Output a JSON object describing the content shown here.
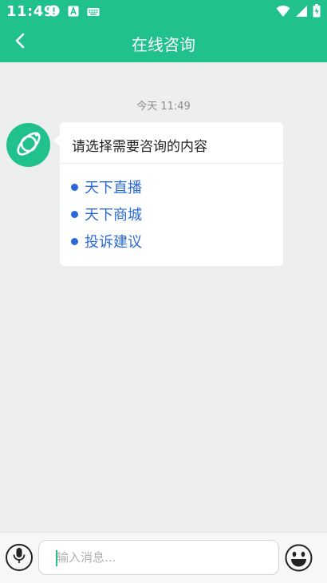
{
  "status_bar": {
    "time": "11:49",
    "left_icons": [
      "alert-icon",
      "app-icon",
      "keyboard-icon"
    ],
    "right_icons": [
      "wifi-icon",
      "signal-icon",
      "battery-icon"
    ]
  },
  "header": {
    "title": "在线咨询",
    "background": "#20c18d",
    "back_icon": "chevron-left-icon"
  },
  "chat": {
    "timestamp": "今天 11:49",
    "bot_avatar_icon": "planet-logo-icon",
    "message": {
      "prompt": "请选择需要咨询的内容",
      "options": [
        {
          "label": "天下直播"
        },
        {
          "label": "天下商城"
        },
        {
          "label": "投诉建议"
        }
      ],
      "link_color": "#2a69d8"
    }
  },
  "input_bar": {
    "voice_icon": "microphone-icon",
    "placeholder": "输入消息...",
    "value": "",
    "emoji_icon": "smiley-icon"
  }
}
